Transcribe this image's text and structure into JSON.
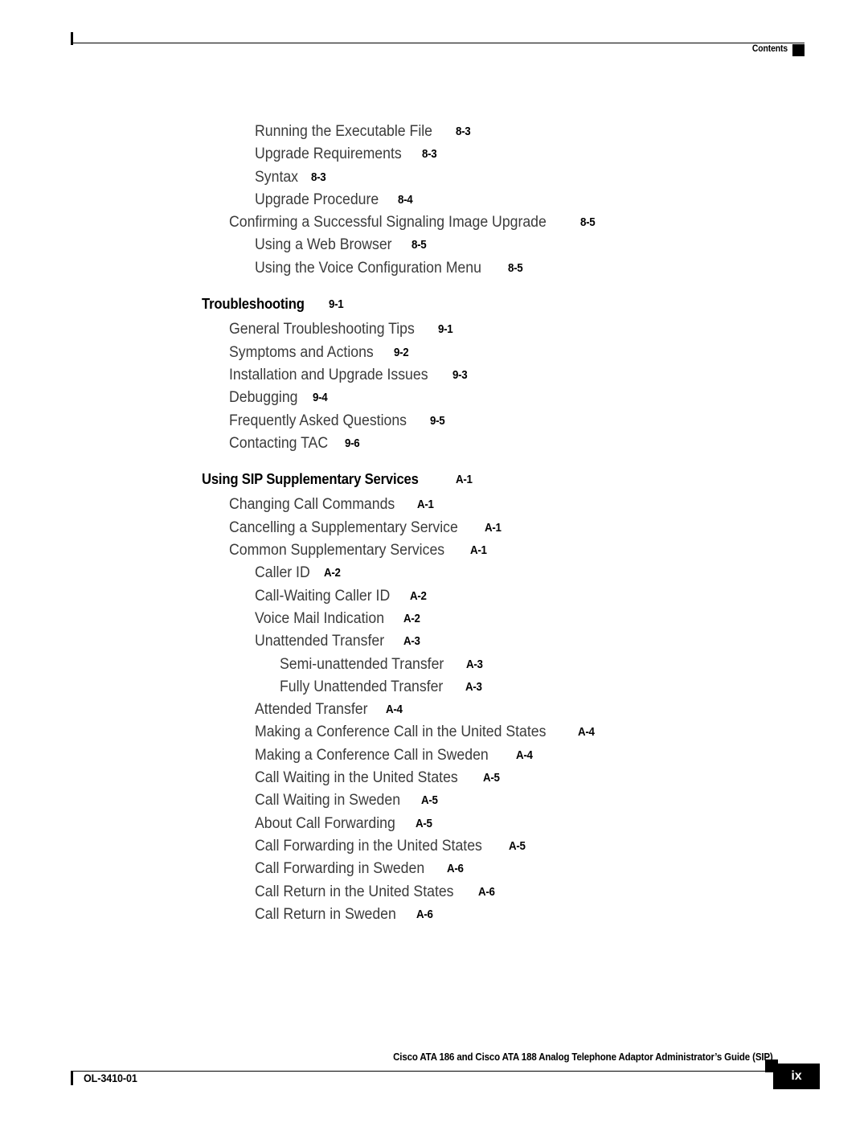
{
  "header": {
    "label": "Contents",
    "marker_icon": "black-square-marker"
  },
  "footer": {
    "doc_id": "OL-3410-01",
    "book_title": "Cisco ATA 186 and Cisco ATA 188 Analog Telephone Adaptor Administrator’s Guide (SIP)",
    "page_number": "ix",
    "marker_icon": "black-square-marker"
  },
  "toc": {
    "entries": [
      {
        "level": 2,
        "title": "Running the Executable File",
        "page": "8-3"
      },
      {
        "level": 2,
        "title": "Upgrade Requirements",
        "page": "8-3"
      },
      {
        "level": 2,
        "title": "Syntax",
        "page": "8-3"
      },
      {
        "level": 2,
        "title": "Upgrade Procedure",
        "page": "8-4"
      },
      {
        "level": 1,
        "title": "Confirming a Successful Signaling Image Upgrade",
        "page": "8-5"
      },
      {
        "level": 2,
        "title": "Using a Web Browser",
        "page": "8-5"
      },
      {
        "level": 2,
        "title": "Using the Voice Configuration Menu",
        "page": "8-5"
      },
      {
        "level": 0,
        "title": "Troubleshooting",
        "page": "9-1"
      },
      {
        "level": 1,
        "title": "General Troubleshooting Tips",
        "page": "9-1"
      },
      {
        "level": 1,
        "title": "Symptoms and Actions",
        "page": "9-2"
      },
      {
        "level": 1,
        "title": "Installation and Upgrade Issues",
        "page": "9-3"
      },
      {
        "level": 1,
        "title": "Debugging",
        "page": "9-4"
      },
      {
        "level": 1,
        "title": "Frequently Asked Questions",
        "page": "9-5"
      },
      {
        "level": 1,
        "title": "Contacting TAC",
        "page": "9-6"
      },
      {
        "level": 0,
        "title": "Using SIP Supplementary Services",
        "page": "A-1"
      },
      {
        "level": 1,
        "title": "Changing Call Commands",
        "page": "A-1"
      },
      {
        "level": 1,
        "title": "Cancelling a Supplementary Service",
        "page": "A-1"
      },
      {
        "level": 1,
        "title": "Common Supplementary Services",
        "page": "A-1"
      },
      {
        "level": 2,
        "title": "Caller ID",
        "page": "A-2"
      },
      {
        "level": 2,
        "title": "Call-Waiting Caller ID",
        "page": "A-2"
      },
      {
        "level": 2,
        "title": "Voice Mail Indication",
        "page": "A-2"
      },
      {
        "level": 2,
        "title": "Unattended Transfer",
        "page": "A-3"
      },
      {
        "level": 3,
        "title": "Semi-unattended Transfer",
        "page": "A-3"
      },
      {
        "level": 3,
        "title": "Fully Unattended Transfer",
        "page": "A-3"
      },
      {
        "level": 2,
        "title": "Attended Transfer",
        "page": "A-4"
      },
      {
        "level": 2,
        "title": "Making a Conference Call in the United States",
        "page": "A-4"
      },
      {
        "level": 2,
        "title": "Making a Conference Call in Sweden",
        "page": "A-4"
      },
      {
        "level": 2,
        "title": "Call Waiting in the United States",
        "page": "A-5"
      },
      {
        "level": 2,
        "title": "Call Waiting in Sweden",
        "page": "A-5"
      },
      {
        "level": 2,
        "title": "About Call Forwarding",
        "page": "A-5"
      },
      {
        "level": 2,
        "title": "Call Forwarding in the United States",
        "page": "A-5"
      },
      {
        "level": 2,
        "title": "Call Forwarding in Sweden",
        "page": "A-6"
      },
      {
        "level": 2,
        "title": "Call Return in the United States",
        "page": "A-6"
      },
      {
        "level": 2,
        "title": "Call Return in Sweden",
        "page": "A-6"
      }
    ]
  }
}
